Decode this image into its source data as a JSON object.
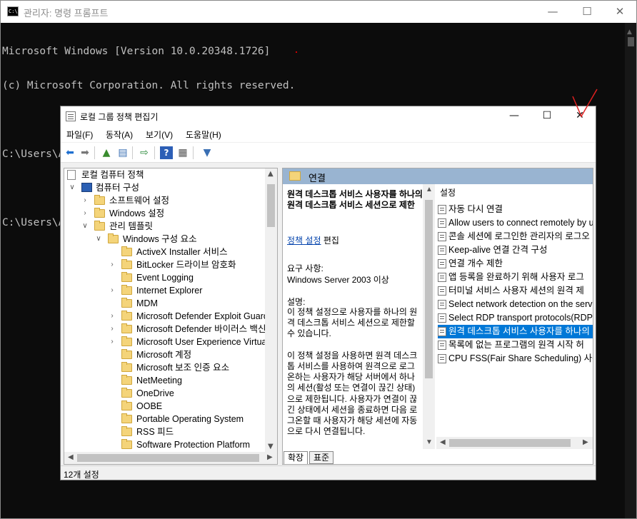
{
  "cmd": {
    "title": "관리자: 명령 프롬프트",
    "icon": "C:\\",
    "minimize": "—",
    "maximize": "☐",
    "close": "✕",
    "lines": [
      "Microsoft Windows [Version 10.0.20348.1726]",
      "(c) Microsoft Corporation. All rights reserved.",
      "",
      "C:\\Users\\Administrator>gpedit.msc",
      "",
      "C:\\Users\\Administrator>"
    ]
  },
  "gpedit": {
    "title": "로컬 그룹 정책 편집기",
    "minimize": "—",
    "maximize": "☐",
    "close": "✕",
    "menu": [
      "파일(F)",
      "동작(A)",
      "보기(V)",
      "도움말(H)"
    ],
    "tree": {
      "root": "로컬 컴퓨터 정책",
      "computer_config": "컴퓨터 구성",
      "software_settings": "소프트웨어 설정",
      "windows_settings": "Windows 설정",
      "admin_templates": "관리 템플릿",
      "windows_components": "Windows 구성 요소",
      "items": [
        {
          "label": "ActiveX Installer 서비스",
          "expandable": false
        },
        {
          "label": "BitLocker 드라이브 암호화",
          "expandable": true
        },
        {
          "label": "Event Logging",
          "expandable": false
        },
        {
          "label": "Internet Explorer",
          "expandable": true
        },
        {
          "label": "MDM",
          "expandable": false
        },
        {
          "label": "Microsoft Defender Exploit Guard",
          "expandable": true
        },
        {
          "label": "Microsoft Defender 바이러스 백신",
          "expandable": true
        },
        {
          "label": "Microsoft User Experience Virtualization",
          "expandable": true
        },
        {
          "label": "Microsoft 계정",
          "expandable": false
        },
        {
          "label": "Microsoft 보조 인증 요소",
          "expandable": false
        },
        {
          "label": "NetMeeting",
          "expandable": false
        },
        {
          "label": "OneDrive",
          "expandable": false
        },
        {
          "label": "OOBE",
          "expandable": false
        },
        {
          "label": "Portable Operating System",
          "expandable": false
        },
        {
          "label": "RSS 피드",
          "expandable": false
        },
        {
          "label": "Software Protection Platform",
          "expandable": false
        }
      ]
    },
    "right_header": "연결",
    "description": {
      "title": "원격 데스크톱 서비스 사용자를 하나의 원격 데스크톱 서비스 세션으로 제한",
      "edit_link": "정책 설정",
      "edit_suffix": " 편집",
      "requirements_label": "요구 사항:",
      "requirements": "Windows Server 2003 이상",
      "desc_label": "설명:",
      "body": "이 정책 설정으로 사용자를 하나의 원격 데스크톱 서비스 세션으로 제한할 수 있습니다.\n\n이 정책 설정을 사용하면 원격 데스크톱 서비스를 사용하여 원격으로 로그온하는 사용자가 해당 서버에서 하나의 세션(활성 또는 연결이 끊긴 상태)으로 제한됩니다. 사용자가 연결이 끊긴 상태에서 세션을 종료하면 다음 로그온할 때 사용자가 해당 세션에 자동으로 다시 연결됩니다."
    },
    "list": {
      "header": "설정",
      "items": [
        {
          "label": "자동 다시 연결",
          "selected": false
        },
        {
          "label": "Allow users to connect remotely by u",
          "selected": false
        },
        {
          "label": "콘솔 세션에 로그인한 관리자의 로그오",
          "selected": false
        },
        {
          "label": "Keep-alive 연결 간격 구성",
          "selected": false
        },
        {
          "label": "연결 개수 제한",
          "selected": false
        },
        {
          "label": "앱 등록을 완료하기 위해 사용자 로그",
          "selected": false
        },
        {
          "label": "터미널 서비스 사용자 세션의 원격 제",
          "selected": false
        },
        {
          "label": "Select network detection on the serv",
          "selected": false
        },
        {
          "label": "Select RDP transport protocols(RDP ",
          "selected": false
        },
        {
          "label": "원격 데스크톱 서비스 사용자를 하나의",
          "selected": true
        },
        {
          "label": "목록에 없는 프로그램의 원격 시작 허",
          "selected": false
        },
        {
          "label": "CPU FSS(Fair Share Scheduling) 사용",
          "selected": false
        }
      ]
    },
    "tabs": [
      "확장",
      "표준"
    ],
    "status": "12개 설정"
  },
  "colors": {
    "console_bg": "#0c0c0c",
    "header_blue": "#99b4d1",
    "selection": "#0078d7",
    "annotation": "#e02020"
  }
}
